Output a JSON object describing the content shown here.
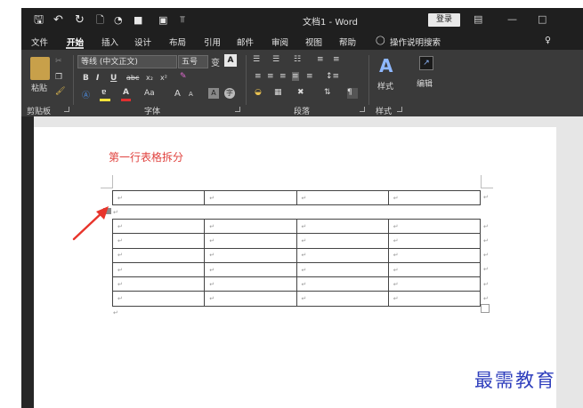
{
  "window": {
    "title": "文档1 - Word",
    "login_label": "登录"
  },
  "menu": {
    "tabs": [
      "文件",
      "开始",
      "插入",
      "设计",
      "布局",
      "引用",
      "邮件",
      "审阅",
      "视图",
      "帮助"
    ],
    "active_tab": "开始",
    "search_label": "操作说明搜索"
  },
  "ribbon": {
    "clipboard": {
      "paste_label": "粘贴",
      "group_label": "剪贴板"
    },
    "font": {
      "font_name": "等线 (中文正文)",
      "font_size": "五号",
      "font_size_icon": "变",
      "bold": "B",
      "italic": "I",
      "underline": "U",
      "strike": "abc",
      "subscript": "x₂",
      "superscript": "x²",
      "change_case": "Aa",
      "grow": "A",
      "shrink": "A",
      "group_label": "字体"
    },
    "paragraph": {
      "group_label": "段落"
    },
    "styles": {
      "styles_label": "样式",
      "group_label": "样式"
    },
    "editing": {
      "editing_label": "编辑"
    }
  },
  "document": {
    "heading": "第一行表格拆分",
    "cell_mark": "↵",
    "first_table": {
      "rows": 1,
      "cols": 4
    },
    "second_table": {
      "rows": 6,
      "cols": 4
    }
  },
  "watermark": "最需教育",
  "colors": {
    "heading": "#e0423e",
    "arrow": "#e8342b",
    "watermark": "#2f3fbd",
    "ribbon_bg": "#3a3a3a",
    "titlebar_bg": "#1f1f1f"
  }
}
